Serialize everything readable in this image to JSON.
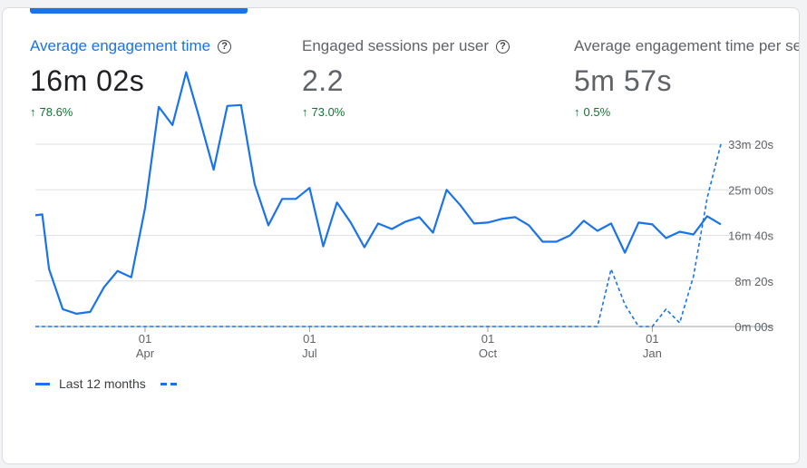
{
  "metrics": [
    {
      "label": "Average engagement time",
      "value": "16m 02s",
      "change": "78.6%"
    },
    {
      "label": "Engaged sessions per user",
      "value": "2.2",
      "change": "73.0%"
    },
    {
      "label": "Average engagement time per session",
      "value": "5m 57s",
      "change": "0.5%"
    }
  ],
  "help_symbol": "?",
  "arrow_symbol": "↑",
  "colors": {
    "accent": "#1a73e8",
    "positive": "#137333",
    "grid": "#e0e0e0"
  },
  "legend": {
    "current": "Last 12 months"
  },
  "chart_data": {
    "type": "line",
    "y_tick_labels": [
      "0m 00s",
      "8m 20s",
      "16m 40s",
      "25m 00s",
      "33m 20s"
    ],
    "y_tick_values": [
      0,
      500,
      1000,
      1500,
      2000
    ],
    "ylim": [
      0,
      2000
    ],
    "x_ticks": [
      {
        "day": "01",
        "month": "Apr",
        "x": 8
      },
      {
        "day": "01",
        "month": "Jul",
        "x": 20
      },
      {
        "day": "01",
        "month": "Oct",
        "x": 33
      },
      {
        "day": "01",
        "month": "Jan",
        "x": 45
      }
    ],
    "x_range": [
      0,
      50
    ],
    "grid": true,
    "legend_position": "bottom-left",
    "series": [
      {
        "name": "Last 12 months",
        "style": "solid",
        "x": [
          0,
          0.5,
          1,
          2,
          3,
          4,
          5,
          6,
          7,
          8,
          9,
          10,
          11,
          12,
          13,
          14,
          15,
          16,
          17,
          18,
          19,
          20,
          21,
          22,
          23,
          24,
          25,
          26,
          27,
          28,
          29,
          30,
          31,
          32,
          33,
          34,
          35,
          36,
          37,
          38,
          39,
          40,
          41,
          42,
          43,
          44,
          45,
          46,
          47,
          48,
          49,
          50
        ],
        "values": [
          1220,
          1230,
          630,
          190,
          140,
          160,
          430,
          610,
          540,
          1300,
          2410,
          2210,
          2790,
          2270,
          1720,
          2420,
          2430,
          1560,
          1110,
          1400,
          1400,
          1520,
          880,
          1360,
          1140,
          870,
          1130,
          1070,
          1150,
          1200,
          1030,
          1500,
          1330,
          1130,
          1140,
          1180,
          1200,
          1110,
          930,
          930,
          1000,
          1160,
          1050,
          1130,
          810,
          1140,
          1120,
          970,
          1040,
          1010,
          1210,
          1120
        ]
      },
      {
        "name": "",
        "style": "dashed",
        "x": [
          0,
          40,
          41,
          42,
          43,
          44,
          45,
          46,
          47,
          48,
          49,
          50
        ],
        "values": [
          0,
          0,
          0,
          630,
          240,
          0,
          0,
          190,
          40,
          550,
          1410,
          2000
        ]
      }
    ]
  }
}
